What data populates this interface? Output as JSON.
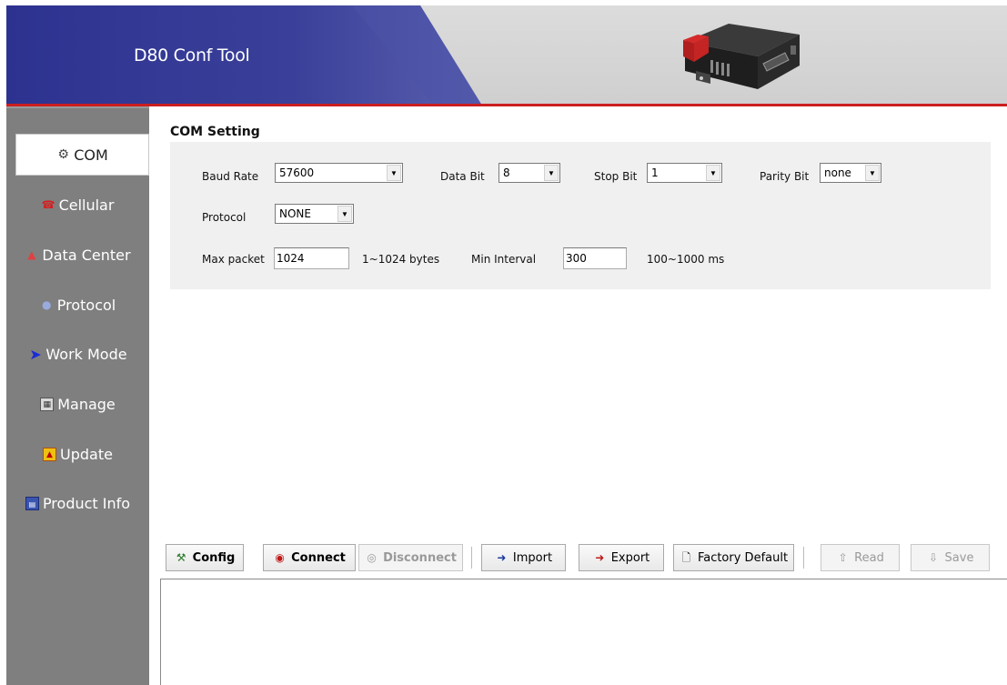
{
  "header": {
    "title": "D80 Conf Tool",
    "accent_color": "#3a3f96",
    "line_color": "#cc1e1e"
  },
  "sidebar": {
    "items": [
      {
        "label": "COM",
        "icon": "serial-port-icon",
        "active": true
      },
      {
        "label": "Cellular",
        "icon": "phone-icon",
        "active": false
      },
      {
        "label": "Data Center",
        "icon": "data-center-icon",
        "active": false
      },
      {
        "label": "Protocol",
        "icon": "protocol-icon",
        "active": false
      },
      {
        "label": "Work Mode",
        "icon": "arrow-right-icon",
        "active": false
      },
      {
        "label": "Manage",
        "icon": "manage-icon",
        "active": false
      },
      {
        "label": "Update",
        "icon": "update-icon",
        "active": false
      },
      {
        "label": "Product Info",
        "icon": "product-info-icon",
        "active": false
      }
    ]
  },
  "com_setting": {
    "title": "COM Setting",
    "baud_rate": {
      "label": "Baud Rate",
      "value": "57600"
    },
    "data_bit": {
      "label": "Data Bit",
      "value": "8"
    },
    "stop_bit": {
      "label": "Stop Bit",
      "value": "1"
    },
    "parity_bit": {
      "label": "Parity Bit",
      "value": "none"
    },
    "protocol": {
      "label": "Protocol",
      "value": "NONE"
    },
    "max_packet": {
      "label": "Max packet",
      "value": "1024",
      "hint": "1~1024 bytes"
    },
    "min_interval": {
      "label": "Min Interval",
      "value": "300",
      "hint": "100~1000 ms"
    }
  },
  "toolbar": {
    "config": "Config",
    "connect": "Connect",
    "disconnect": "Disconnect",
    "import": "Import",
    "export": "Export",
    "factory_default": "Factory Default",
    "read": "Read",
    "save": "Save"
  }
}
